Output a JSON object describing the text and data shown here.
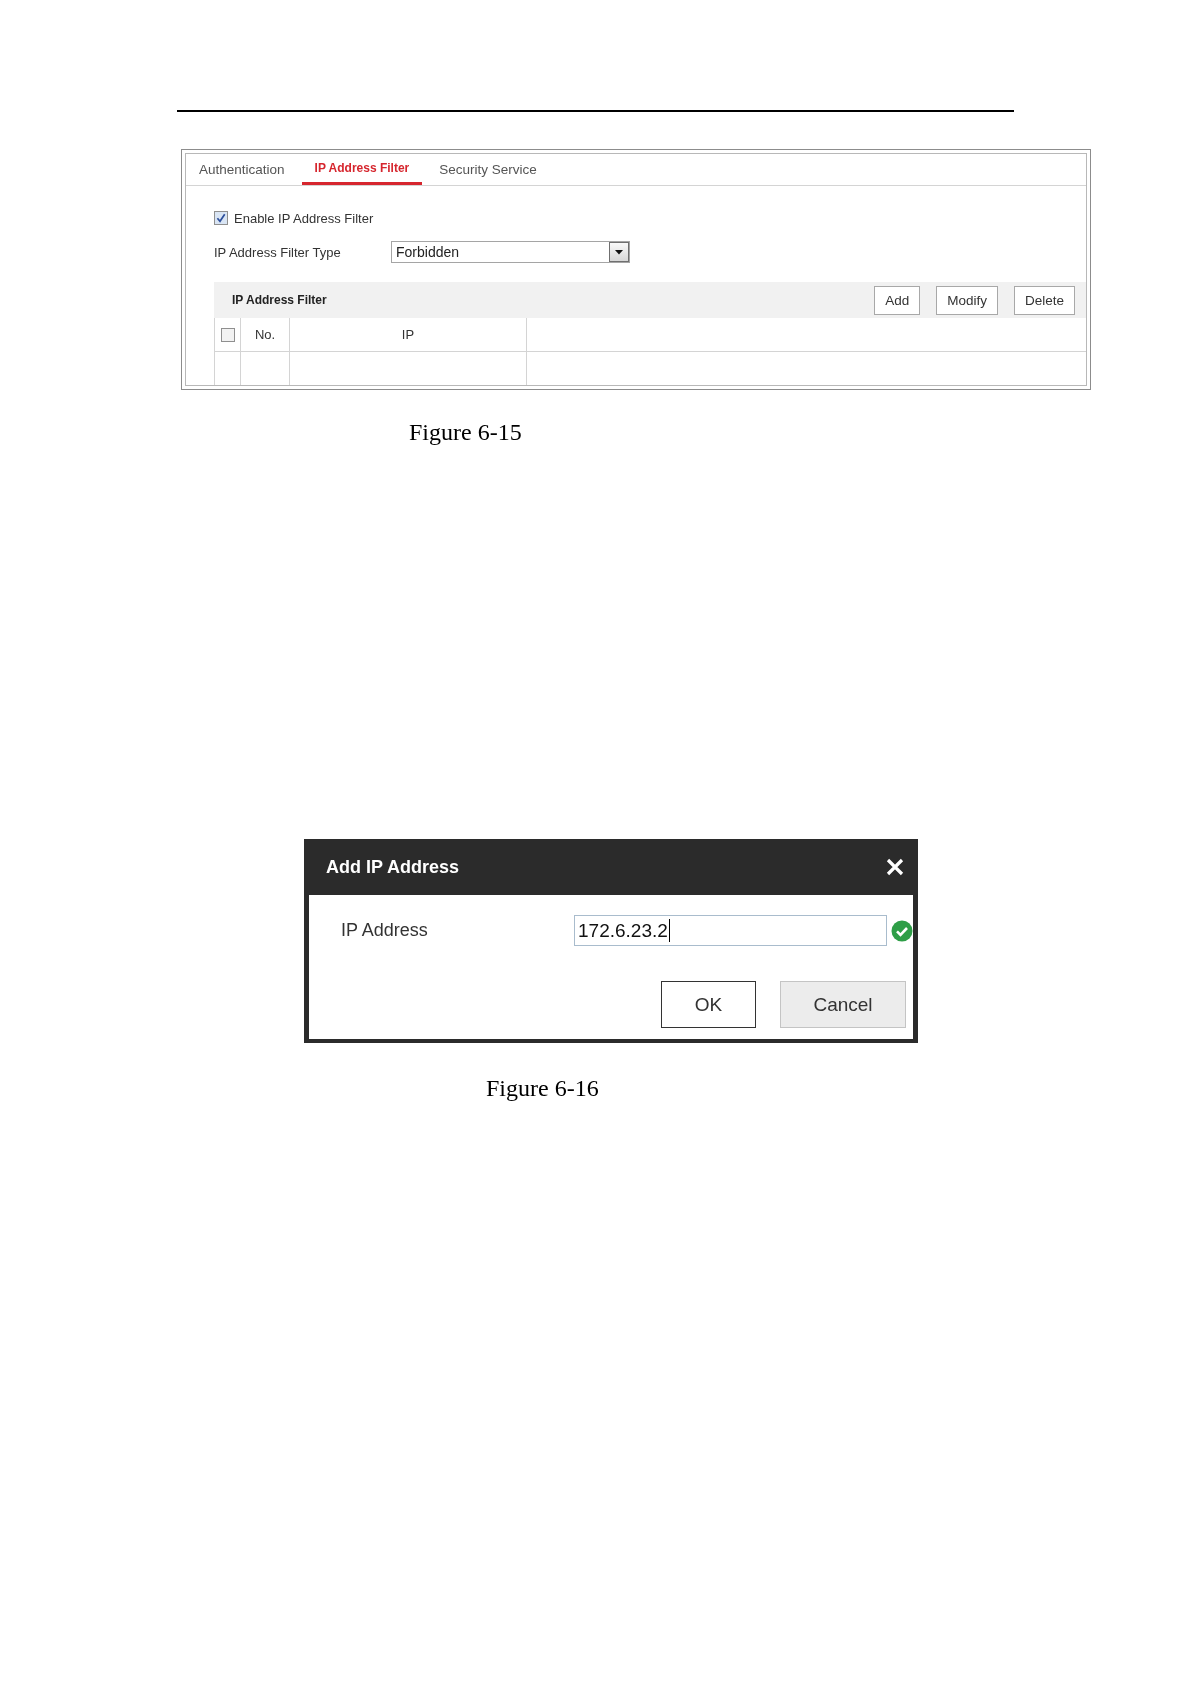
{
  "figures": [
    {
      "kind": "settings-panel",
      "tabs": [
        {
          "label": "Authentication",
          "selected": false
        },
        {
          "label": "IP Address Filter",
          "selected": true
        },
        {
          "label": "Security Service",
          "selected": false
        }
      ],
      "enable_filter": {
        "label": "Enable IP Address Filter",
        "checked": true
      },
      "filter_type": {
        "label": "IP Address Filter Type",
        "value": "Forbidden"
      },
      "filter_list": {
        "title": "IP Address Filter",
        "buttons": [
          "Add",
          "Modify",
          "Delete"
        ],
        "select_all": {
          "checked": false
        },
        "columns": [
          "No.",
          "IP"
        ]
      },
      "caption": "Figure 6-15"
    },
    {
      "kind": "dialog",
      "title": "Add IP Address",
      "field": {
        "label": "IP Address",
        "value": "172.6.23.2",
        "valid": true
      },
      "buttons": [
        {
          "label": "OK",
          "kind": "primary"
        },
        {
          "label": "Cancel",
          "kind": "secondary"
        }
      ],
      "caption": "Figure 6-16"
    }
  ]
}
